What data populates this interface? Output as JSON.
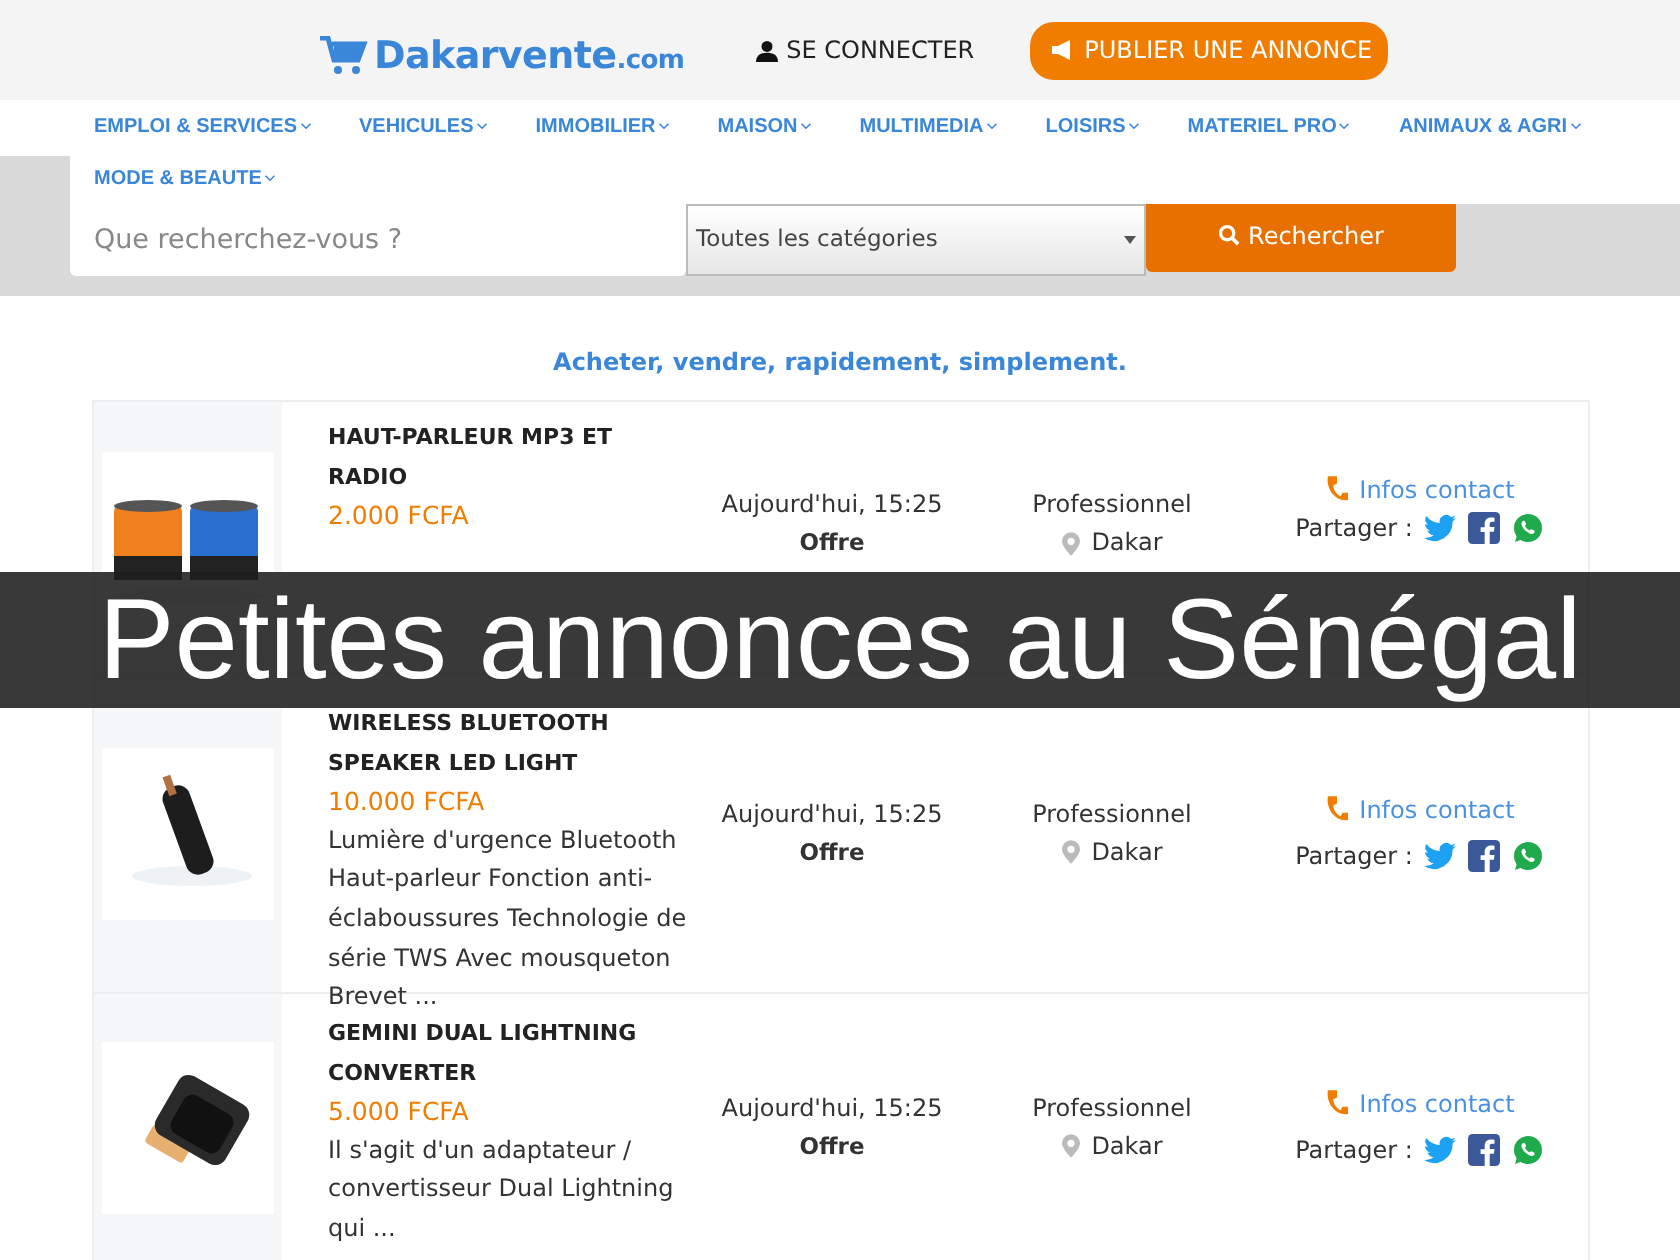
{
  "header": {
    "logo": {
      "name": "Dakarvente",
      "suffix": ".com"
    },
    "login": "SE CONNECTER",
    "publish_button": "PUBLIER UNE ANNONCE"
  },
  "nav": [
    {
      "label": "EMPLOI & SERVICES"
    },
    {
      "label": "VEHICULES"
    },
    {
      "label": "IMMOBILIER"
    },
    {
      "label": "MAISON"
    },
    {
      "label": "MULTIMEDIA"
    },
    {
      "label": "LOISIRS"
    },
    {
      "label": "MATERIEL PRO"
    },
    {
      "label": "ANIMAUX & AGRI"
    },
    {
      "label": "MODE & BEAUTE"
    }
  ],
  "search": {
    "placeholder": "Que recherchez-vous ?",
    "category": "Toutes les catégories",
    "button": "Rechercher"
  },
  "tagline": "Acheter, vendre, rapidement, simplement.",
  "listings": [
    {
      "title": "HAUT-PARLEUR MP3 ET RADIO",
      "price": "2.000 FCFA",
      "date": "Aujourd'hui, 15:25",
      "type": "Offre",
      "seller": "Professionnel",
      "location": "Dakar",
      "contact": "Infos contact",
      "share": "Partager :"
    },
    {
      "title": "WIRELESS BLUETOOTH SPEAKER LED LIGHT",
      "price": "10.000 FCFA",
      "description": "Lumière d'urgence Bluetooth Haut-parleur Fonction anti-éclaboussures Technologie de série TWS Avec mousqueton Brevet ...",
      "date": "Aujourd'hui, 15:25",
      "type": "Offre",
      "seller": "Professionnel",
      "location": "Dakar",
      "contact": "Infos contact",
      "share": "Partager :"
    },
    {
      "title": "GEMINI DUAL LIGHTNING CONVERTER",
      "price": "5.000 FCFA",
      "description": "Il s'agit d'un adaptateur / convertisseur Dual Lightning qui ...",
      "date": "Aujourd'hui, 15:25",
      "type": "Offre",
      "seller": "Professionnel",
      "location": "Dakar",
      "contact": "Infos contact",
      "share": "Partager :"
    }
  ],
  "banner": "Petites annonces au Sénégal"
}
